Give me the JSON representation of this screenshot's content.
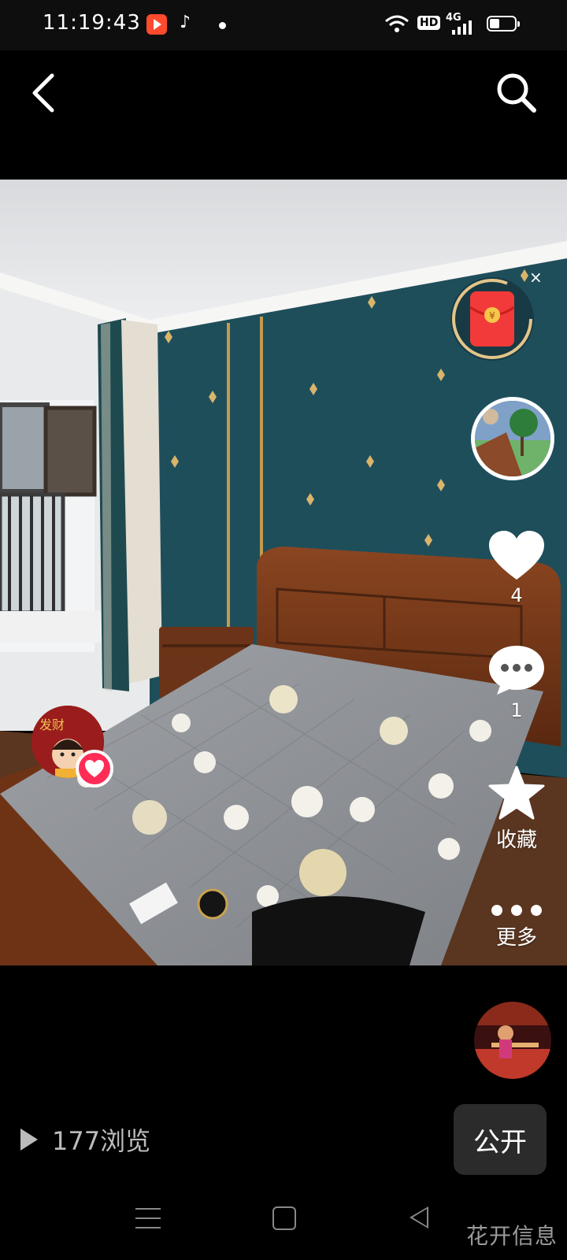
{
  "status_bar": {
    "time": "11:19:43",
    "hd_label": "HD",
    "network_label": "4G"
  },
  "top_nav": {
    "back_icon": "chevron-left-icon",
    "search_icon": "search-icon"
  },
  "rail": {
    "red_packet_close": "×",
    "like_count": "4",
    "comment_count": "1",
    "favorite_label": "收藏",
    "more_label": "更多"
  },
  "bottom": {
    "views_text": "177浏览",
    "public_label": "公开"
  },
  "watermark": "花开信息",
  "colors": {
    "wall": "#1f4e5b",
    "wood": "#6e3315",
    "mattress": "#8f9196",
    "accent_red": "#ff2d55",
    "gold": "#e7c46b"
  }
}
